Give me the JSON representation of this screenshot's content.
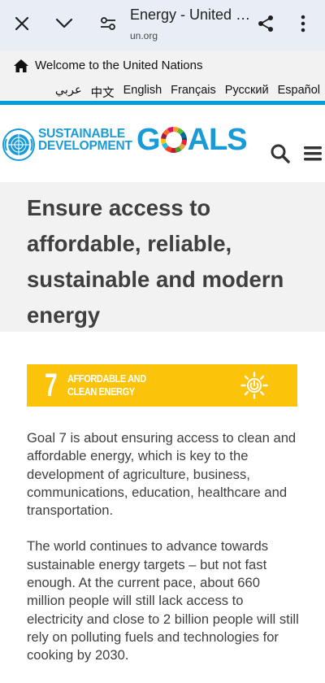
{
  "browser": {
    "title": "Energy - United Nations Sustainable Development",
    "url": "un.org"
  },
  "un_bar": {
    "welcome": "Welcome to the United Nations",
    "languages": [
      "عربي",
      "中文",
      "English",
      "Français",
      "Русский",
      "Español"
    ]
  },
  "header": {
    "logo_line1": "SUSTAINABLE",
    "logo_line2": "DEVELOPMENT",
    "logo_goals_g": "G",
    "logo_goals_rest": "ALS"
  },
  "page": {
    "title": "Ensure access to affordable, reliable, sustainable and modern energy",
    "goal_banner": {
      "number": "7",
      "label_line1": "AFFORDABLE AND",
      "label_line2": "CLEAN ENERGY",
      "color": "#fcc30b"
    },
    "paragraphs": [
      "Goal 7 is about ensuring access to clean and affordable energy, which is key to the development of agriculture, business, communications, education, healthcare and transportation.",
      "The world continues to advance towards sustainable energy targets – but not fast enough. At the current pace, about 660 million people will still lack access to electricity and close to 2 billion people will still rely on polluting fuels and technologies for cooking by 2030."
    ]
  },
  "colors": {
    "un_blue": "#009edb",
    "sdg_blue": "#1a9bd7",
    "goal7_yellow": "#fcc30b"
  }
}
